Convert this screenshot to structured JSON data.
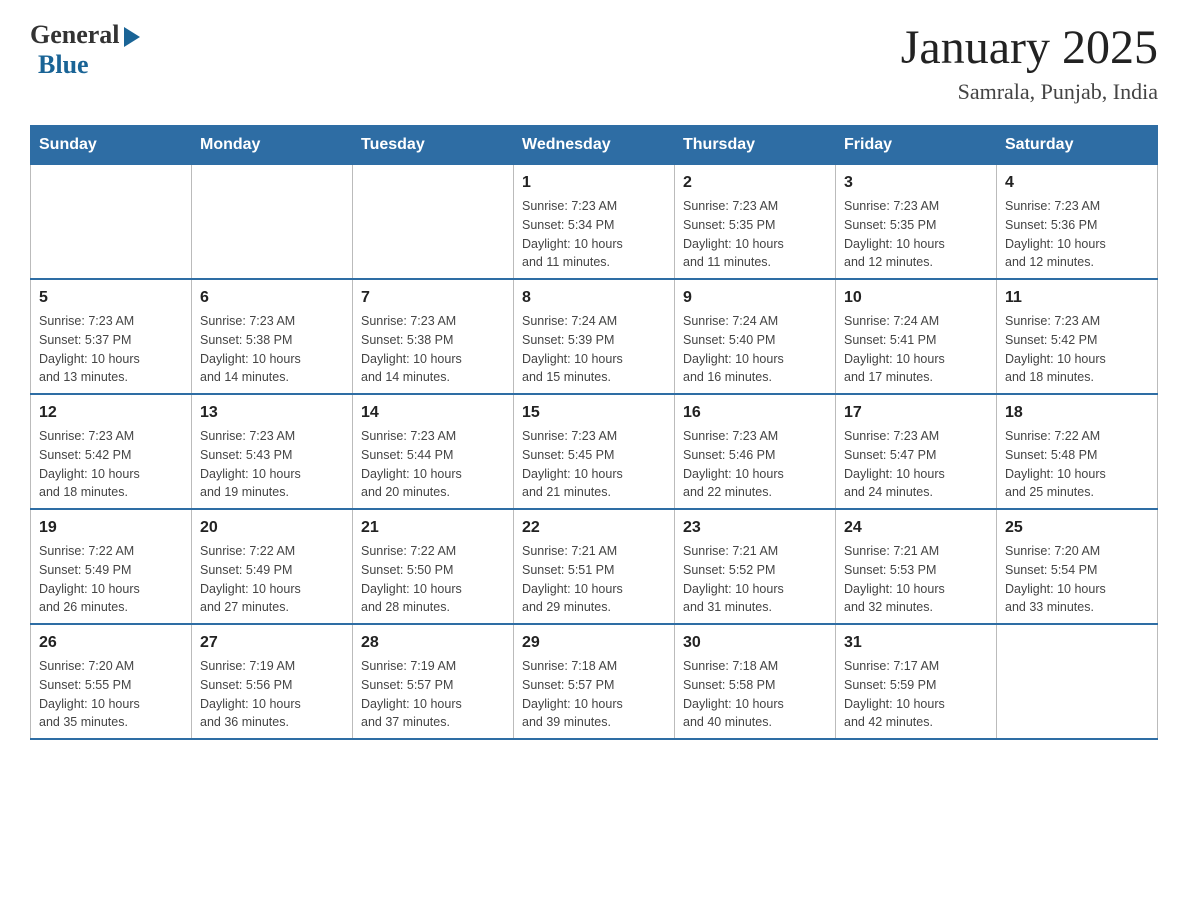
{
  "logo": {
    "general": "General",
    "blue": "Blue"
  },
  "title": "January 2025",
  "location": "Samrala, Punjab, India",
  "days_of_week": [
    "Sunday",
    "Monday",
    "Tuesday",
    "Wednesday",
    "Thursday",
    "Friday",
    "Saturday"
  ],
  "weeks": [
    [
      {
        "day": "",
        "info": ""
      },
      {
        "day": "",
        "info": ""
      },
      {
        "day": "",
        "info": ""
      },
      {
        "day": "1",
        "info": "Sunrise: 7:23 AM\nSunset: 5:34 PM\nDaylight: 10 hours\nand 11 minutes."
      },
      {
        "day": "2",
        "info": "Sunrise: 7:23 AM\nSunset: 5:35 PM\nDaylight: 10 hours\nand 11 minutes."
      },
      {
        "day": "3",
        "info": "Sunrise: 7:23 AM\nSunset: 5:35 PM\nDaylight: 10 hours\nand 12 minutes."
      },
      {
        "day": "4",
        "info": "Sunrise: 7:23 AM\nSunset: 5:36 PM\nDaylight: 10 hours\nand 12 minutes."
      }
    ],
    [
      {
        "day": "5",
        "info": "Sunrise: 7:23 AM\nSunset: 5:37 PM\nDaylight: 10 hours\nand 13 minutes."
      },
      {
        "day": "6",
        "info": "Sunrise: 7:23 AM\nSunset: 5:38 PM\nDaylight: 10 hours\nand 14 minutes."
      },
      {
        "day": "7",
        "info": "Sunrise: 7:23 AM\nSunset: 5:38 PM\nDaylight: 10 hours\nand 14 minutes."
      },
      {
        "day": "8",
        "info": "Sunrise: 7:24 AM\nSunset: 5:39 PM\nDaylight: 10 hours\nand 15 minutes."
      },
      {
        "day": "9",
        "info": "Sunrise: 7:24 AM\nSunset: 5:40 PM\nDaylight: 10 hours\nand 16 minutes."
      },
      {
        "day": "10",
        "info": "Sunrise: 7:24 AM\nSunset: 5:41 PM\nDaylight: 10 hours\nand 17 minutes."
      },
      {
        "day": "11",
        "info": "Sunrise: 7:23 AM\nSunset: 5:42 PM\nDaylight: 10 hours\nand 18 minutes."
      }
    ],
    [
      {
        "day": "12",
        "info": "Sunrise: 7:23 AM\nSunset: 5:42 PM\nDaylight: 10 hours\nand 18 minutes."
      },
      {
        "day": "13",
        "info": "Sunrise: 7:23 AM\nSunset: 5:43 PM\nDaylight: 10 hours\nand 19 minutes."
      },
      {
        "day": "14",
        "info": "Sunrise: 7:23 AM\nSunset: 5:44 PM\nDaylight: 10 hours\nand 20 minutes."
      },
      {
        "day": "15",
        "info": "Sunrise: 7:23 AM\nSunset: 5:45 PM\nDaylight: 10 hours\nand 21 minutes."
      },
      {
        "day": "16",
        "info": "Sunrise: 7:23 AM\nSunset: 5:46 PM\nDaylight: 10 hours\nand 22 minutes."
      },
      {
        "day": "17",
        "info": "Sunrise: 7:23 AM\nSunset: 5:47 PM\nDaylight: 10 hours\nand 24 minutes."
      },
      {
        "day": "18",
        "info": "Sunrise: 7:22 AM\nSunset: 5:48 PM\nDaylight: 10 hours\nand 25 minutes."
      }
    ],
    [
      {
        "day": "19",
        "info": "Sunrise: 7:22 AM\nSunset: 5:49 PM\nDaylight: 10 hours\nand 26 minutes."
      },
      {
        "day": "20",
        "info": "Sunrise: 7:22 AM\nSunset: 5:49 PM\nDaylight: 10 hours\nand 27 minutes."
      },
      {
        "day": "21",
        "info": "Sunrise: 7:22 AM\nSunset: 5:50 PM\nDaylight: 10 hours\nand 28 minutes."
      },
      {
        "day": "22",
        "info": "Sunrise: 7:21 AM\nSunset: 5:51 PM\nDaylight: 10 hours\nand 29 minutes."
      },
      {
        "day": "23",
        "info": "Sunrise: 7:21 AM\nSunset: 5:52 PM\nDaylight: 10 hours\nand 31 minutes."
      },
      {
        "day": "24",
        "info": "Sunrise: 7:21 AM\nSunset: 5:53 PM\nDaylight: 10 hours\nand 32 minutes."
      },
      {
        "day": "25",
        "info": "Sunrise: 7:20 AM\nSunset: 5:54 PM\nDaylight: 10 hours\nand 33 minutes."
      }
    ],
    [
      {
        "day": "26",
        "info": "Sunrise: 7:20 AM\nSunset: 5:55 PM\nDaylight: 10 hours\nand 35 minutes."
      },
      {
        "day": "27",
        "info": "Sunrise: 7:19 AM\nSunset: 5:56 PM\nDaylight: 10 hours\nand 36 minutes."
      },
      {
        "day": "28",
        "info": "Sunrise: 7:19 AM\nSunset: 5:57 PM\nDaylight: 10 hours\nand 37 minutes."
      },
      {
        "day": "29",
        "info": "Sunrise: 7:18 AM\nSunset: 5:57 PM\nDaylight: 10 hours\nand 39 minutes."
      },
      {
        "day": "30",
        "info": "Sunrise: 7:18 AM\nSunset: 5:58 PM\nDaylight: 10 hours\nand 40 minutes."
      },
      {
        "day": "31",
        "info": "Sunrise: 7:17 AM\nSunset: 5:59 PM\nDaylight: 10 hours\nand 42 minutes."
      },
      {
        "day": "",
        "info": ""
      }
    ]
  ]
}
